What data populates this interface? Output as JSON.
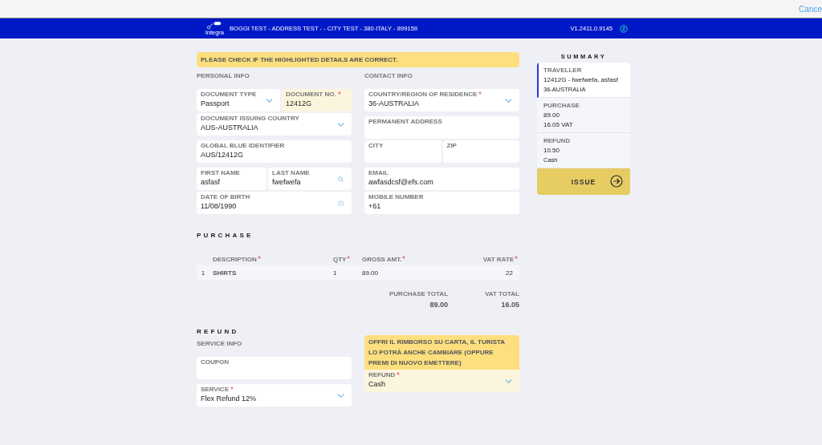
{
  "top_bar": {
    "cancel_link": "Cance"
  },
  "header": {
    "brand": "Integra",
    "title": "BOGGI TEST - ADDRESS TEST - - CITY TEST - 380-ITALY - 899159",
    "version": "V1.2411.0.9145"
  },
  "alert": "PLEASE CHECK IF THE HIGHLIGHTED DETAILS ARE CORRECT.",
  "personal_info": {
    "label": "PERSONAL INFO",
    "cards": [
      {
        "rows": [
          [
            {
              "label": "DOCUMENT TYPE",
              "value": "Passport",
              "kind": "select",
              "required": false,
              "highlighted": false
            },
            {
              "label": "DOCUMENT NO.",
              "value": "12412G",
              "kind": "text",
              "required": true,
              "highlighted": true
            }
          ],
          [
            {
              "label": "DOCUMENT ISSUING COUNTRY",
              "value": "AUS-AUSTRALIA",
              "kind": "select",
              "required": false,
              "highlighted": false
            }
          ]
        ]
      },
      {
        "rows": [
          [
            {
              "label": "GLOBAL BLUE IDENTIFIER",
              "value": "AUS/12412G",
              "kind": "text",
              "required": false,
              "highlighted": false
            }
          ]
        ]
      },
      {
        "rows": [
          [
            {
              "label": "FIRST NAME",
              "value": "asfasf",
              "kind": "text",
              "required": false,
              "highlighted": false
            },
            {
              "label": "LAST NAME",
              "value": "fwefwefa",
              "kind": "search",
              "required": false,
              "highlighted": false
            }
          ],
          [
            {
              "label": "DATE OF BIRTH",
              "value": "11/08/1990",
              "kind": "date",
              "required": false,
              "highlighted": false
            }
          ]
        ]
      }
    ]
  },
  "contact_info": {
    "label": "CONTACT INFO",
    "cards": [
      {
        "rows": [
          [
            {
              "label": "COUNTRY/REGION OF RESIDENCE",
              "value": "36-AUSTRALIA",
              "kind": "select",
              "required": true,
              "highlighted": false
            }
          ]
        ]
      },
      {
        "rows": [
          [
            {
              "label": "PERMANENT ADDRESS",
              "kind": "text",
              "required": false,
              "highlighted": false
            }
          ],
          [
            {
              "label": "CITY",
              "kind": "text",
              "required": false,
              "highlighted": false
            },
            {
              "label": "ZIP",
              "kind": "text",
              "required": false,
              "highlighted": false
            }
          ]
        ]
      },
      {
        "rows": [
          [
            {
              "label": "EMAIL",
              "value": "awfasdcsf@efs.com",
              "kind": "text",
              "required": false,
              "highlighted": false
            }
          ],
          [
            {
              "label": "MOBILE NUMBER",
              "value": "+61",
              "kind": "text",
              "required": false,
              "highlighted": false
            }
          ]
        ]
      }
    ]
  },
  "purchase": {
    "title": "PURCHASE",
    "columns": [
      {
        "label": "DESCRIPTION",
        "required": true
      },
      {
        "label": "QTY",
        "required": true
      },
      {
        "label": "GROSS AMT.",
        "required": true
      },
      {
        "label": "VAT RATE",
        "required": true
      }
    ],
    "rows": [
      {
        "index": "1",
        "description": "SHIRTS",
        "qty": "1",
        "gross": "89.00",
        "vat_rate": "22"
      }
    ],
    "totals": [
      {
        "label": "PURCHASE TOTAL",
        "value": "89.00"
      },
      {
        "label": "VAT TOTAL",
        "value": "16.05"
      }
    ]
  },
  "refund": {
    "title": "REFUND",
    "service_label": "SERVICE INFO",
    "left_cards": [
      {
        "rows": [
          [
            {
              "label": "COUPON",
              "kind": "text",
              "required": false,
              "highlighted": false
            }
          ]
        ]
      },
      {
        "rows": [
          [
            {
              "label": "SERVICE",
              "value": "Flex Refund 12%",
              "kind": "select",
              "required": true,
              "highlighted": false
            }
          ]
        ]
      }
    ],
    "note": "OFFRI IL RIMBORSO SU CARTA, IL TURISTA LO POTRÀ ANCHE CAMBIARE (OPPURE PREMI DI NUOVO EMETTERE)",
    "refund_field": {
      "label": "REFUND",
      "value": "Cash",
      "kind": "select",
      "required": true,
      "highlighted": true
    }
  },
  "summary": {
    "title": "SUMMARY",
    "items": [
      {
        "label": "TRAVELLER",
        "lines": [
          "12412G  -  fwefwefa, asfasf",
          "36-AUSTRALIA"
        ],
        "selected": true
      },
      {
        "label": "PURCHASE",
        "lines": [
          "89.00",
          "16.05 VAT"
        ],
        "selected": false
      },
      {
        "label": "REFUND",
        "lines": [
          "10.50",
          "Cash"
        ],
        "selected": false
      }
    ],
    "issue_button": "ISSUE"
  }
}
